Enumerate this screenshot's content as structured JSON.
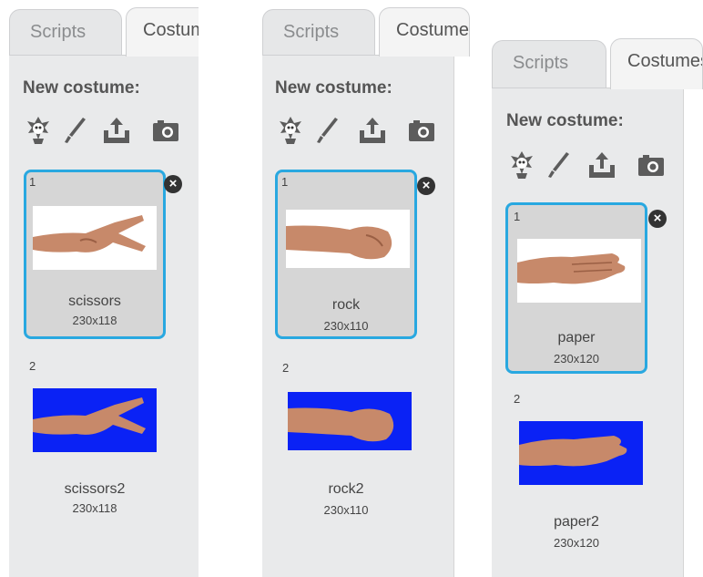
{
  "panels": [
    {
      "tabs": {
        "scripts": "Scripts",
        "costumes": "Costumes"
      },
      "new_costume_label": "New costume:",
      "icons": [
        "choose-costume-from-library-icon",
        "paint-new-costume-icon",
        "upload-costume-icon",
        "camera-icon"
      ],
      "costumes": [
        {
          "number": "1",
          "name": "scissors",
          "size": "230x118",
          "selected": true,
          "hand": "scissors",
          "background": "white"
        },
        {
          "number": "2",
          "name": "scissors2",
          "size": "230x118",
          "selected": false,
          "hand": "scissors",
          "background": "blue"
        }
      ]
    },
    {
      "tabs": {
        "scripts": "Scripts",
        "costumes": "Costumes"
      },
      "new_costume_label": "New costume:",
      "icons": [
        "choose-costume-from-library-icon",
        "paint-new-costume-icon",
        "upload-costume-icon",
        "camera-icon"
      ],
      "costumes": [
        {
          "number": "1",
          "name": "rock",
          "size": "230x110",
          "selected": true,
          "hand": "rock",
          "background": "white"
        },
        {
          "number": "2",
          "name": "rock2",
          "size": "230x110",
          "selected": false,
          "hand": "rock",
          "background": "blue"
        }
      ]
    },
    {
      "tabs": {
        "scripts": "Scripts",
        "costumes": "Costumes"
      },
      "new_costume_label": "New costume:",
      "icons": [
        "choose-costume-from-library-icon",
        "paint-new-costume-icon",
        "upload-costume-icon",
        "camera-icon"
      ],
      "costumes": [
        {
          "number": "1",
          "name": "paper",
          "size": "230x120",
          "selected": true,
          "hand": "paper",
          "background": "white"
        },
        {
          "number": "2",
          "name": "paper2",
          "size": "230x120",
          "selected": false,
          "hand": "paper",
          "background": "blue"
        }
      ]
    }
  ],
  "colors": {
    "selection_border": "#29a8e0",
    "costume_blue_bg": "#0a22f5",
    "panel_bg": "#e9eaeb"
  }
}
